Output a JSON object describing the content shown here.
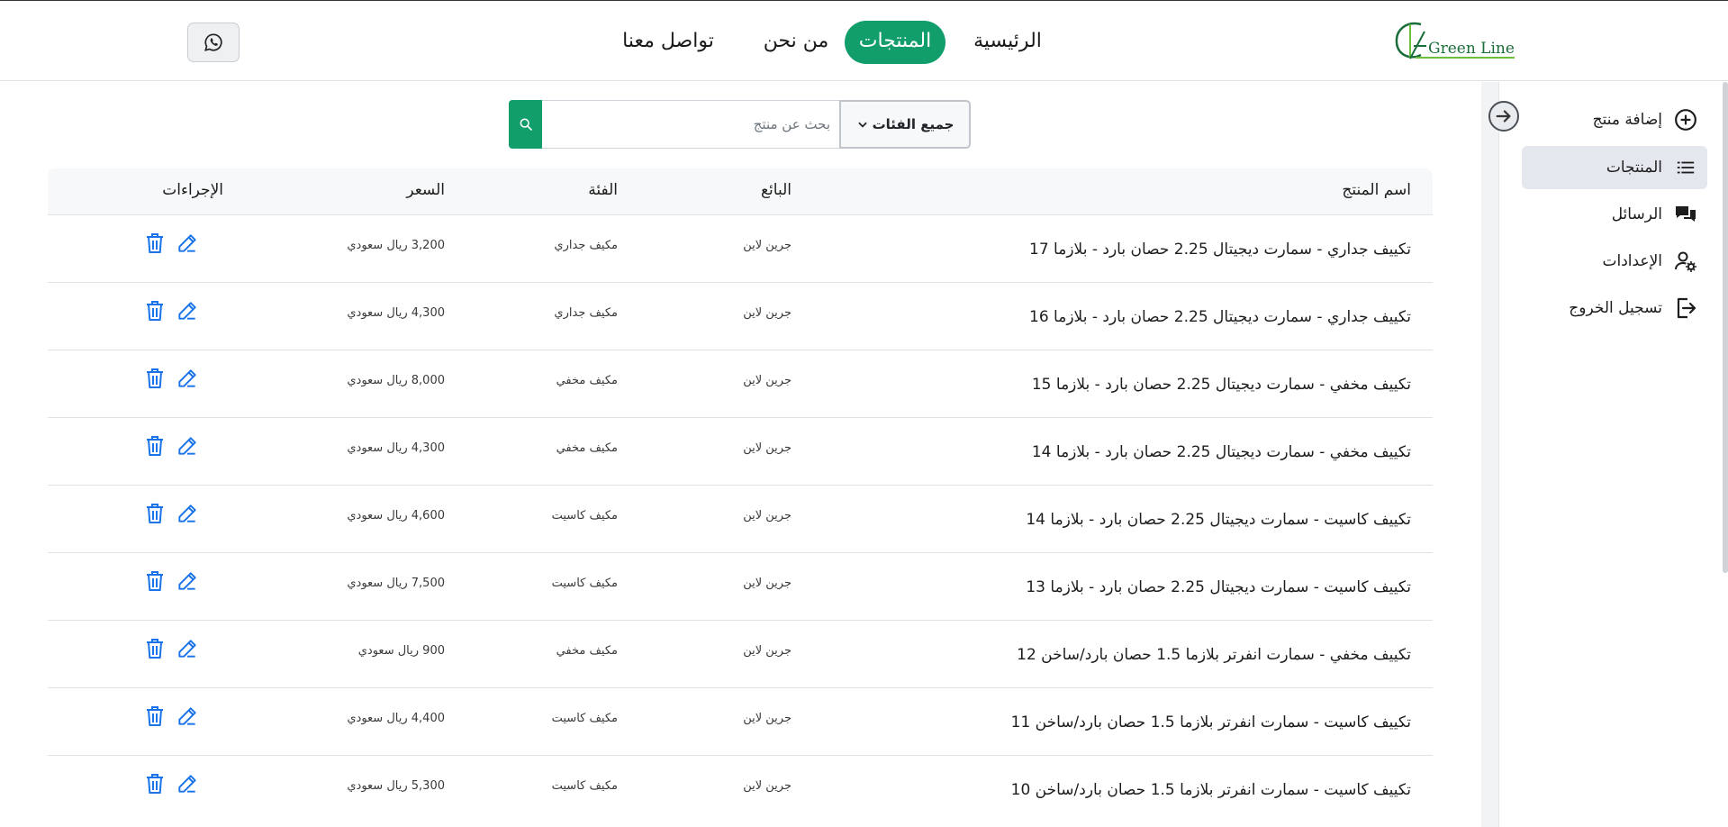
{
  "header": {
    "logo_text": "Green Line",
    "nav": [
      {
        "label": "الرئيسية",
        "active": false
      },
      {
        "label": "المنتجات",
        "active": true
      },
      {
        "label": "من نحن",
        "active": false
      },
      {
        "label": "تواصل معنا",
        "active": false
      }
    ],
    "whatsapp_icon": "whatsapp-icon"
  },
  "sidebar": {
    "items": [
      {
        "label": "إضافة منتج",
        "icon": "plus-circle-icon"
      },
      {
        "label": "المنتجات",
        "icon": "list-icon",
        "active": true
      },
      {
        "label": "الرسائل",
        "icon": "chat-icon"
      },
      {
        "label": "الإعدادات",
        "icon": "user-gear-icon"
      },
      {
        "label": "تسجيل الخروج",
        "icon": "logout-icon"
      }
    ]
  },
  "search": {
    "placeholder": "بحث عن منتج",
    "category_label": "جميع الفئات"
  },
  "table": {
    "headers": {
      "name": "اسم المنتج",
      "seller": "البائع",
      "category": "الفئة",
      "price": "السعر",
      "actions": "الإجراءات"
    },
    "rows": [
      {
        "name": "تكييف جداري - سمارت ديجيتال 2.25 حصان بارد - بلازما 17",
        "seller": "جرين لاين",
        "category": "مكيف جداري",
        "price": "3,200 ريال سعودي"
      },
      {
        "name": "تكييف جداري - سمارت ديجيتال 2.25 حصان بارد - بلازما 16",
        "seller": "جرين لاين",
        "category": "مكيف جداري",
        "price": "4,300 ريال سعودي"
      },
      {
        "name": "تكييف مخفي - سمارت ديجيتال 2.25 حصان بارد - بلازما 15",
        "seller": "جرين لاين",
        "category": "مكيف مخفي",
        "price": "8,000 ريال سعودي"
      },
      {
        "name": "تكييف مخفي - سمارت ديجيتال 2.25 حصان بارد - بلازما 14",
        "seller": "جرين لاين",
        "category": "مكيف مخفي",
        "price": "4,300 ريال سعودي"
      },
      {
        "name": "تكييف كاسيت - سمارت ديجيتال 2.25 حصان بارد - بلازما 14",
        "seller": "جرين لاين",
        "category": "مكيف كاسيت",
        "price": "4,600 ريال سعودي"
      },
      {
        "name": "تكييف كاسيت - سمارت ديجيتال 2.25 حصان بارد - بلازما 13",
        "seller": "جرين لاين",
        "category": "مكيف كاسيت",
        "price": "7,500 ريال سعودي"
      },
      {
        "name": "تكييف مخفي - سمارت انفرتر بلازما 1.5 حصان بارد/ساخن 12",
        "seller": "جرين لاين",
        "category": "مكيف مخفي",
        "price": "900 ريال سعودي"
      },
      {
        "name": "تكييف كاسيت - سمارت انفرتر بلازما 1.5 حصان بارد/ساخن 11",
        "seller": "جرين لاين",
        "category": "مكيف كاسيت",
        "price": "4,400 ريال سعودي"
      },
      {
        "name": "تكييف كاسيت - سمارت انفرتر بلازما 1.5 حصان بارد/ساخن 10",
        "seller": "جرين لاين",
        "category": "مكيف كاسيت",
        "price": "5,300 ريال سعودي"
      }
    ]
  },
  "colors": {
    "accent": "#129e6b",
    "action_icon": "#1a73e8"
  }
}
